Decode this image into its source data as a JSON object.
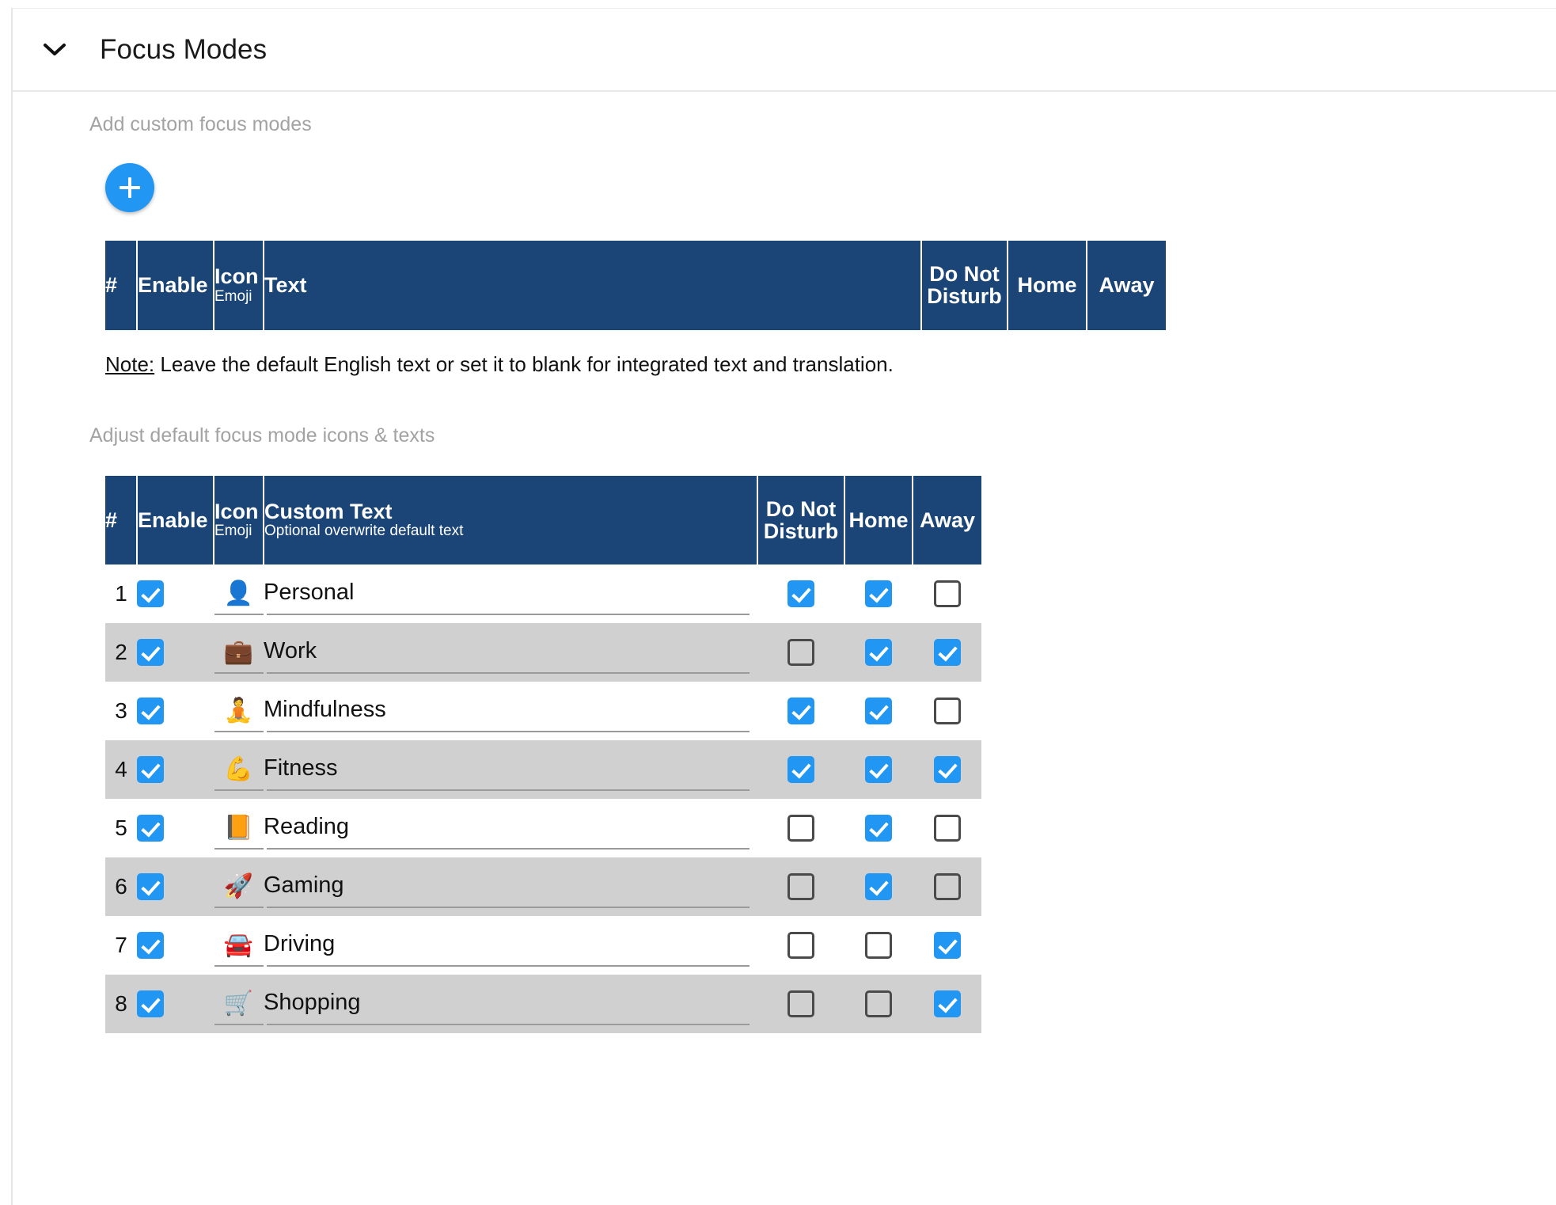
{
  "panel": {
    "title": "Focus Modes",
    "collapse_icon": "chevron-down-icon",
    "expanded": true
  },
  "colors": {
    "table_header_bg": "#1b4576",
    "accent_blue": "#2196f3",
    "alt_row_bg": "#d0d0d0",
    "section_label": "#a3a3a3",
    "underline": "#9a9a9a",
    "checkbox_border": "#4a4a4a"
  },
  "custom_section": {
    "label": "Add custom focus modes",
    "add_button": {
      "icon": "plus-icon",
      "label": "+"
    },
    "table": {
      "columns": [
        {
          "main": "#",
          "sub": ""
        },
        {
          "main": "Enable",
          "sub": ""
        },
        {
          "main": "Icon",
          "sub": "Emoji"
        },
        {
          "main": "Text",
          "sub": ""
        },
        {
          "main": "Do Not Disturb",
          "sub": ""
        },
        {
          "main": "Home",
          "sub": ""
        },
        {
          "main": "Away",
          "sub": ""
        }
      ],
      "rows": []
    },
    "note_prefix": "Note:",
    "note_body": " Leave the default English text or set it to blank for integrated text and translation."
  },
  "default_section": {
    "label": "Adjust default focus mode icons & texts",
    "table": {
      "columns": [
        {
          "main": "#",
          "sub": ""
        },
        {
          "main": "Enable",
          "sub": ""
        },
        {
          "main": "Icon",
          "sub": "Emoji"
        },
        {
          "main": "Custom Text",
          "sub": "Optional overwrite default text"
        },
        {
          "main": "Do Not Disturb",
          "sub": ""
        },
        {
          "main": "Home",
          "sub": ""
        },
        {
          "main": "Away",
          "sub": ""
        }
      ],
      "rows": [
        {
          "num": "1",
          "enable": true,
          "icon": "👤",
          "icon_name": "bust-in-silhouette-icon",
          "text": "Personal",
          "dnd": true,
          "home": true,
          "away": false
        },
        {
          "num": "2",
          "enable": true,
          "icon": "💼",
          "icon_name": "briefcase-icon",
          "text": "Work",
          "dnd": false,
          "home": true,
          "away": true
        },
        {
          "num": "3",
          "enable": true,
          "icon": "🧘",
          "icon_name": "person-in-lotus-position-icon",
          "text": "Mindfulness",
          "dnd": true,
          "home": true,
          "away": false
        },
        {
          "num": "4",
          "enable": true,
          "icon": "💪",
          "icon_name": "flexed-biceps-icon",
          "text": "Fitness",
          "dnd": true,
          "home": true,
          "away": true
        },
        {
          "num": "5",
          "enable": true,
          "icon": "📙",
          "icon_name": "orange-book-icon",
          "text": "Reading",
          "dnd": false,
          "home": true,
          "away": false
        },
        {
          "num": "6",
          "enable": true,
          "icon": "🚀",
          "icon_name": "rocket-icon",
          "text": "Gaming",
          "dnd": false,
          "home": true,
          "away": false
        },
        {
          "num": "7",
          "enable": true,
          "icon": "🚘",
          "icon_name": "oncoming-automobile-icon",
          "text": "Driving",
          "dnd": false,
          "home": false,
          "away": true
        },
        {
          "num": "8",
          "enable": true,
          "icon": "🛒",
          "icon_name": "shopping-cart-icon",
          "text": "Shopping",
          "dnd": false,
          "home": false,
          "away": true
        }
      ]
    }
  }
}
